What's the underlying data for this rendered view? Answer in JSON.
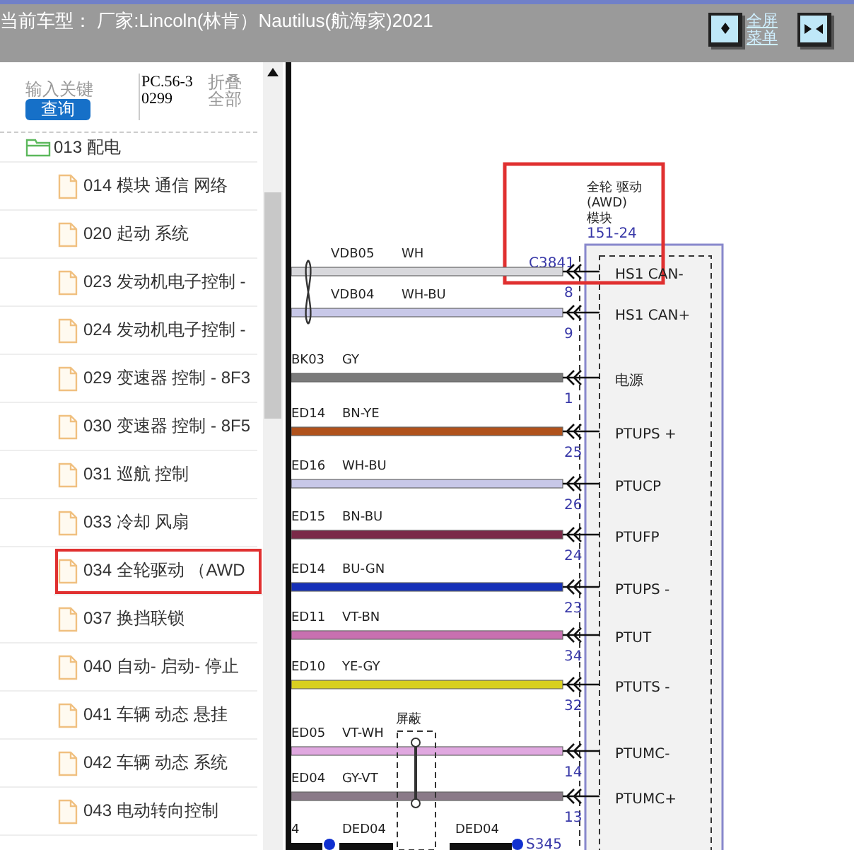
{
  "header": {
    "title": "当前车型： 厂家:Lincoln(林肯）Nautilus(航海家)2021",
    "buttons": [
      {
        "kind": "fullscreen",
        "label_lines": [
          "全屏",
          "菜单"
        ]
      },
      {
        "kind": "default-view"
      }
    ]
  },
  "search": {
    "placeholder": "输入关键",
    "button": "查询",
    "code": "PC.56-30299",
    "collapse": "折叠全部"
  },
  "tree": [
    {
      "label": "013 配电",
      "expanded": true,
      "children": [
        {
          "label": "014 模块 通信 网络",
          "selected": false
        },
        {
          "label": "020 起动 系统",
          "selected": false
        },
        {
          "label": "023 发动机电子控制 -",
          "selected": false
        },
        {
          "label": "024 发动机电子控制 -",
          "selected": false
        },
        {
          "label": "029 变速器 控制 - 8F3",
          "selected": false
        },
        {
          "label": "030 变速器 控制 - 8F5",
          "selected": false
        },
        {
          "label": "031 巡航 控制",
          "selected": false
        },
        {
          "label": "033 冷却 风扇",
          "selected": false
        },
        {
          "label": "034 全轮驱动 （AWD",
          "selected": true
        },
        {
          "label": "037 换挡联锁",
          "selected": false
        },
        {
          "label": "040 自动- 启动- 停止",
          "selected": false
        },
        {
          "label": "041 车辆 动态 悬挂",
          "selected": false
        },
        {
          "label": "042 车辆 动态 系统",
          "selected": false
        },
        {
          "label": "043 电动转向控制",
          "selected": false
        }
      ]
    }
  ],
  "module": {
    "name_lines": [
      "全轮 驱动",
      "(AWD)",
      "模块"
    ],
    "page": "151-24",
    "connector": "C3841",
    "highlighted": true
  },
  "wires": [
    {
      "circuit": "VDB05",
      "code": "WH",
      "pin": "8",
      "signal": "HS1 CAN-",
      "color": "#d8d8dc",
      "kind": "twisted-pair"
    },
    {
      "circuit": "VDB04",
      "code": "WH-BU",
      "pin": "9",
      "signal": "HS1 CAN+",
      "color": "#c8c8e8",
      "kind": "twisted-pair"
    },
    {
      "circuit": "BK03",
      "code": "GY",
      "pin": "1",
      "signal": "电源",
      "color": "#7a7a7a"
    },
    {
      "circuit": "ED14",
      "code": "BN-YE",
      "pin": "25",
      "signal": "PTUPS +",
      "color": "#b0521c"
    },
    {
      "circuit": "ED16",
      "code": "WH-BU",
      "pin": "26",
      "signal": "PTUCP",
      "color": "#c8c8e8"
    },
    {
      "circuit": "ED15",
      "code": "BN-BU",
      "pin": "24",
      "signal": "PTUFP",
      "color": "#7a2a48"
    },
    {
      "circuit": "ED14",
      "code": "BU-GN",
      "pin": "23",
      "signal": "PTUPS -",
      "color": "#1630b8"
    },
    {
      "circuit": "ED11",
      "code": "VT-BN",
      "pin": "34",
      "signal": "PTUT",
      "color": "#c870b0"
    },
    {
      "circuit": "ED10",
      "code": "YE-GY",
      "pin": "32",
      "signal": "PTUTS -",
      "color": "#d8d020"
    },
    {
      "circuit": "ED05",
      "code": "VT-WH",
      "pin": "14",
      "signal": "PTUMC-",
      "color": "#e0a8e0"
    },
    {
      "circuit": "ED04",
      "code": "GY-VT",
      "pin": "13",
      "signal": "PTUMC+",
      "color": "#8a7a88"
    }
  ],
  "shield": {
    "label": "屏蔽"
  },
  "bottom_wire": {
    "left_label": "4",
    "labels": [
      "DED04",
      "DED04"
    ],
    "splice": "S345"
  }
}
